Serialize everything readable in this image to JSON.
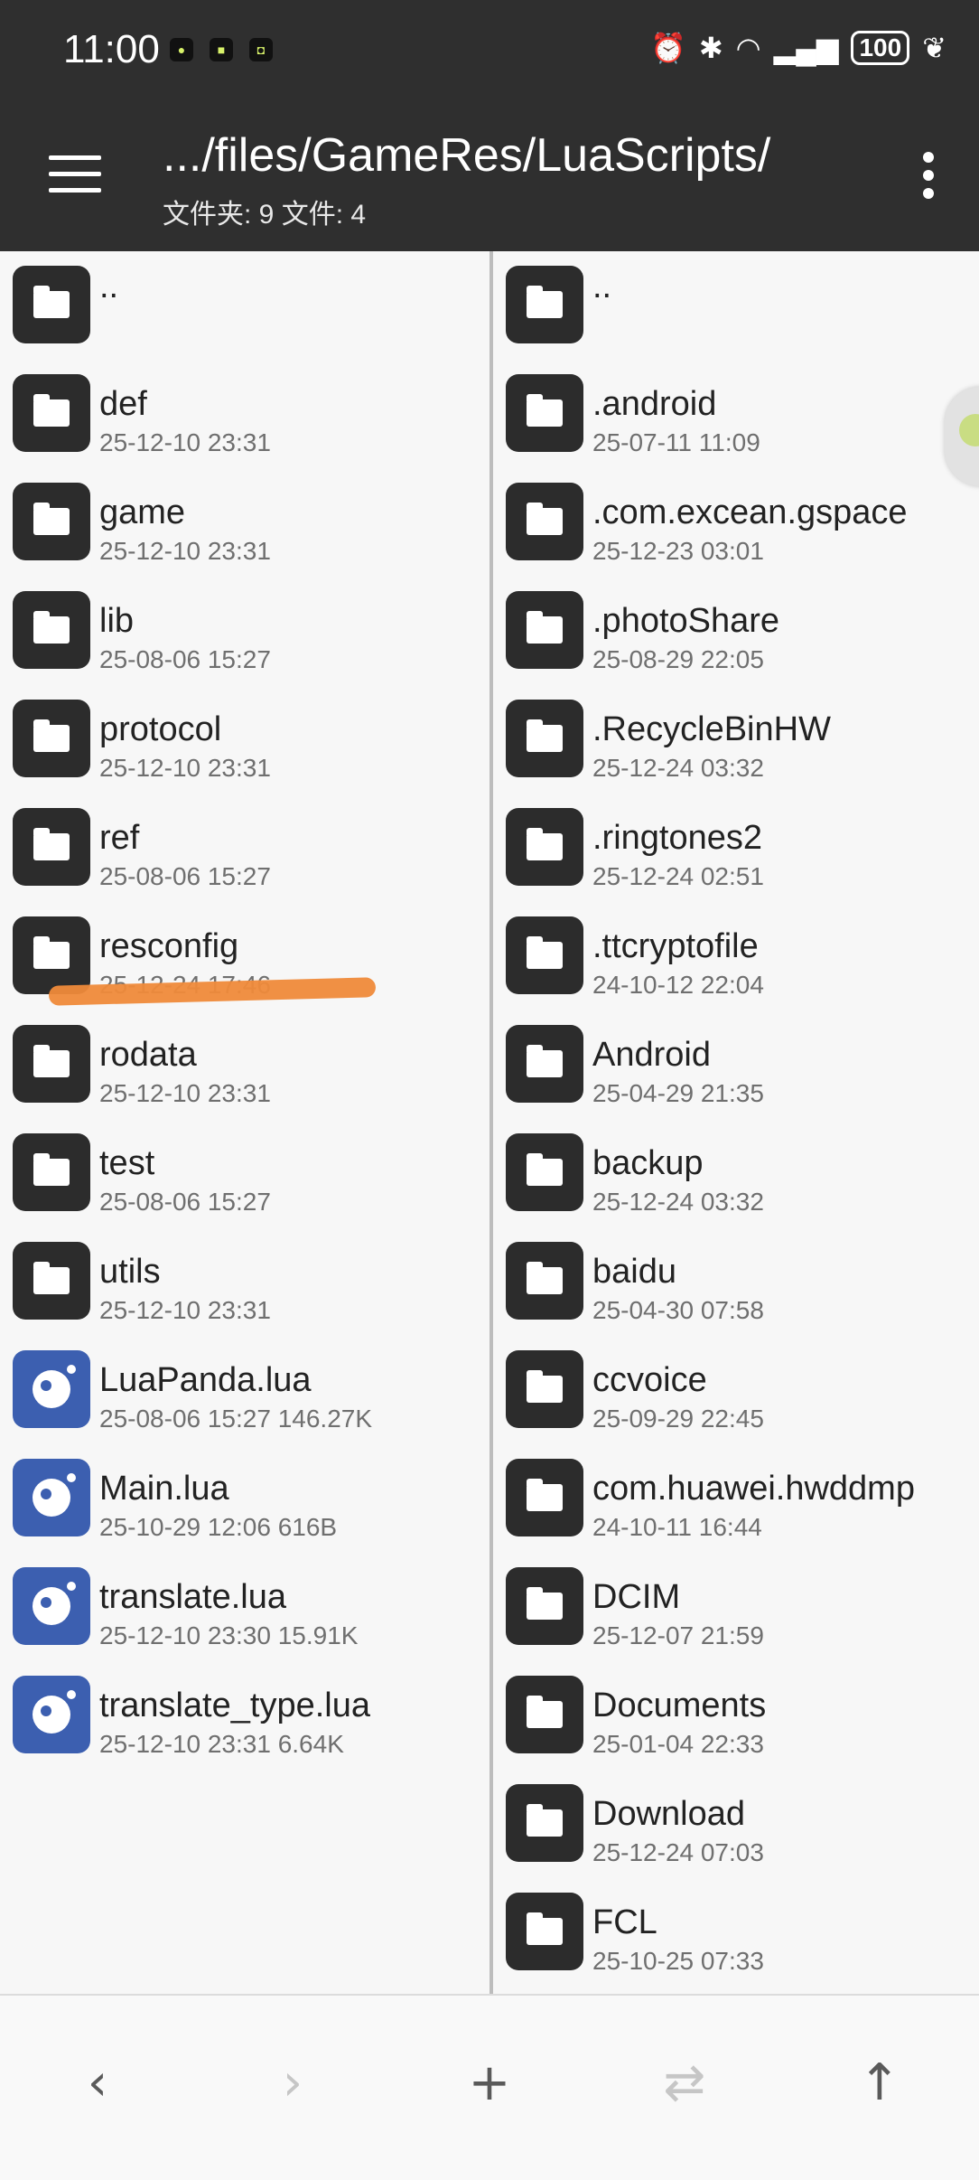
{
  "status_bar": {
    "time": "11:00",
    "left_icons": [
      "app-notification-icon",
      "app-notification-icon-2",
      "app-notification-icon-3"
    ],
    "battery": "100"
  },
  "header": {
    "path": ".../files/GameRes/LuaScripts/",
    "counts": "文件夹: 9  文件: 4"
  },
  "left_pane": {
    "items": [
      {
        "name": "..",
        "meta": "",
        "kind": "folder"
      },
      {
        "name": "def",
        "meta": "25-12-10 23:31",
        "kind": "folder"
      },
      {
        "name": "game",
        "meta": "25-12-10 23:31",
        "kind": "folder"
      },
      {
        "name": "lib",
        "meta": "25-08-06 15:27",
        "kind": "folder"
      },
      {
        "name": "protocol",
        "meta": "25-12-10 23:31",
        "kind": "folder"
      },
      {
        "name": "ref",
        "meta": "25-08-06 15:27",
        "kind": "folder"
      },
      {
        "name": "resconfig",
        "meta": "25-12-24 17:46",
        "kind": "folder"
      },
      {
        "name": "rodata",
        "meta": "25-12-10 23:31",
        "kind": "folder"
      },
      {
        "name": "test",
        "meta": "25-08-06 15:27",
        "kind": "folder"
      },
      {
        "name": "utils",
        "meta": "25-12-10 23:31",
        "kind": "folder"
      },
      {
        "name": "LuaPanda.lua",
        "meta": "25-08-06 15:27  146.27K",
        "kind": "lua"
      },
      {
        "name": "Main.lua",
        "meta": "25-10-29 12:06  616B",
        "kind": "lua"
      },
      {
        "name": "translate.lua",
        "meta": "25-12-10 23:30  15.91K",
        "kind": "lua"
      },
      {
        "name": "translate_type.lua",
        "meta": "25-12-10 23:31  6.64K",
        "kind": "lua"
      }
    ]
  },
  "right_pane": {
    "items": [
      {
        "name": "..",
        "meta": "",
        "kind": "folder"
      },
      {
        "name": ".android",
        "meta": "25-07-11 11:09",
        "kind": "folder"
      },
      {
        "name": ".com.excean.gspace",
        "meta": "25-12-23 03:01",
        "kind": "folder"
      },
      {
        "name": ".photoShare",
        "meta": "25-08-29 22:05",
        "kind": "folder"
      },
      {
        "name": ".RecycleBinHW",
        "meta": "25-12-24 03:32",
        "kind": "folder"
      },
      {
        "name": ".ringtones2",
        "meta": "25-12-24 02:51",
        "kind": "folder"
      },
      {
        "name": ".ttcryptofile",
        "meta": "24-10-12 22:04",
        "kind": "folder"
      },
      {
        "name": "Android",
        "meta": "25-04-29 21:35",
        "kind": "folder"
      },
      {
        "name": "backup",
        "meta": "25-12-24 03:32",
        "kind": "folder"
      },
      {
        "name": "baidu",
        "meta": "25-04-30 07:58",
        "kind": "folder"
      },
      {
        "name": "ccvoice",
        "meta": "25-09-29 22:45",
        "kind": "folder"
      },
      {
        "name": "com.huawei.hwddmp",
        "meta": "24-10-11 16:44",
        "kind": "folder"
      },
      {
        "name": "DCIM",
        "meta": "25-12-07 21:59",
        "kind": "folder"
      },
      {
        "name": "Documents",
        "meta": "25-01-04 22:33",
        "kind": "folder"
      },
      {
        "name": "Download",
        "meta": "25-12-24 07:03",
        "kind": "folder"
      },
      {
        "name": "FCL",
        "meta": "25-10-25 07:33",
        "kind": "folder"
      }
    ]
  },
  "toolbar": {
    "back": "‹",
    "forward": "›",
    "add": "+",
    "swap": "⇄",
    "up": "↑"
  }
}
